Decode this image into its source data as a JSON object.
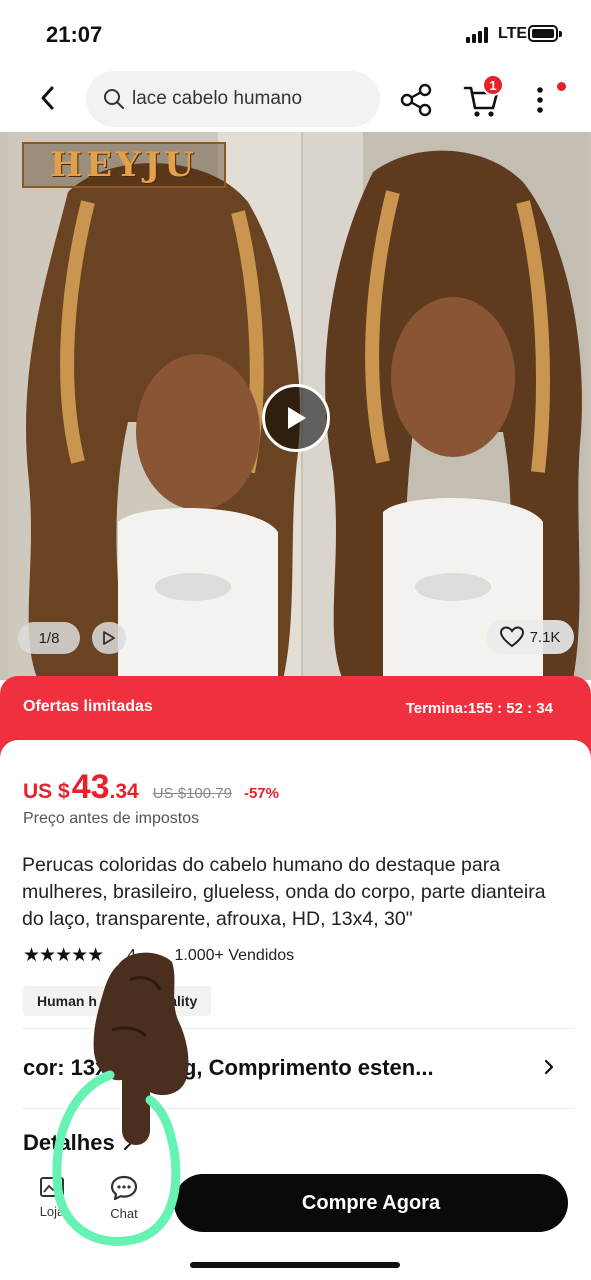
{
  "status_bar": {
    "time": "21:07",
    "network": "LTE"
  },
  "header": {
    "search_text": "lace cabelo humano",
    "cart_count": "1"
  },
  "gallery": {
    "brand_logo_text": "HEYJU",
    "image_counter": "1/8",
    "likes": "7.1K"
  },
  "offer": {
    "title": "Ofertas limitadas",
    "timer": "Termina:155 : 52 : 34",
    "accent_color": "#f0303f"
  },
  "product": {
    "currency": "US $",
    "price_integer": "43",
    "price_decimal": ".34",
    "original_price": "US $100.79",
    "discount": "-57%",
    "price_note": "Preço antes de impostos",
    "title": "Perucas coloridas do cabelo humano do destaque para mulheres, brasileiro, glueless, onda do corpo, parte dianteira do laço, transparente, afrouxa, HD, 13x4, 30\"",
    "rating_stars": "★★★★★",
    "rating_value": "4.",
    "sold": "1.000+ Vendidos",
    "tag": "Human h           d quality",
    "variant": "cor: 13x4      Wig, Comprimento esten...",
    "details_label": "Detalhes"
  },
  "bottom_bar": {
    "store_label": "Loja",
    "chat_label": "Chat",
    "buy_label": "Compre Agora"
  },
  "colors": {
    "price_red": "#e8202a",
    "annotation_green": "#66f2b4"
  }
}
